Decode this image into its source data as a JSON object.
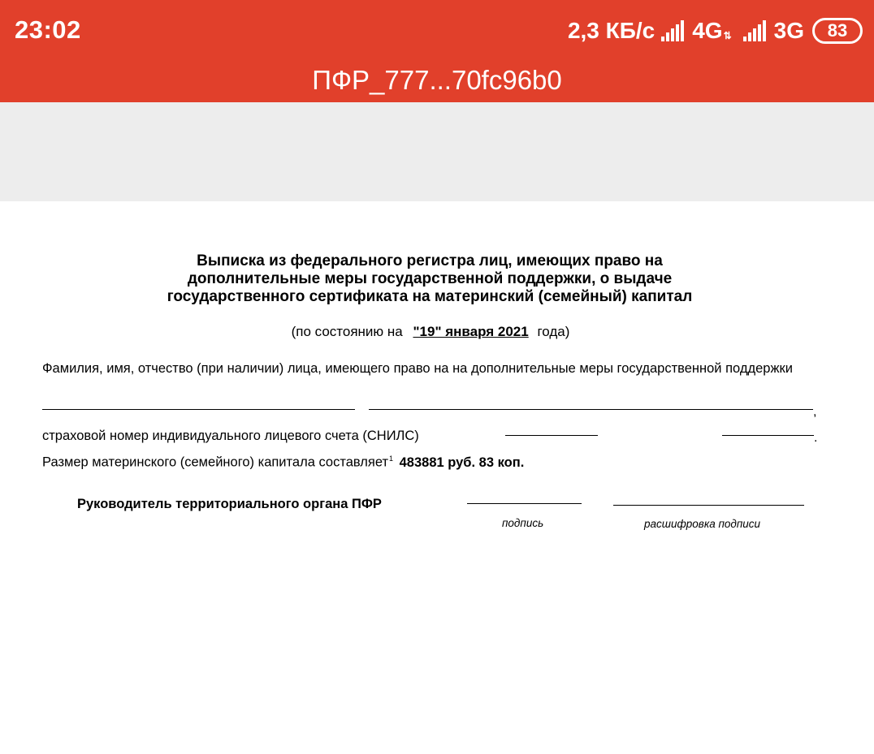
{
  "status_bar": {
    "time": "23:02",
    "speed": "2,3 КБ/с",
    "network1": "4G",
    "network2": "3G",
    "battery": "83"
  },
  "viewer": {
    "title": "ПФР_777...70fc96b0"
  },
  "document": {
    "heading_line1": "Выписка из федерального регистра лиц, имеющих право на",
    "heading_line2": "дополнительные меры государственной поддержки, о выдаче",
    "heading_line3": "государственного сертификата на материнский (семейный) капитал",
    "as_of_prefix": "(по состоянию на",
    "as_of_date": "\"19\" января 2021",
    "as_of_suffix": "года)",
    "fio_label": "Фамилия, имя, отчество (при наличии) лица, имеющего право на на дополнительные меры государственной поддержки",
    "snils_label": "страховой номер индивидуального лицевого счета (СНИЛС)",
    "capital_label": "Размер материнского (семейного) капитала составляет",
    "capital_footnote": "1",
    "capital_amount": "483881 руб. 83 коп.",
    "head_label": "Руководитель территориального органа ПФР",
    "signature_caption": "подпись",
    "decoding_caption": "расшифровка подписи"
  },
  "colors": {
    "appbar": "#e1402b",
    "toolbar_band": "#ededed",
    "page": "#ffffff"
  }
}
